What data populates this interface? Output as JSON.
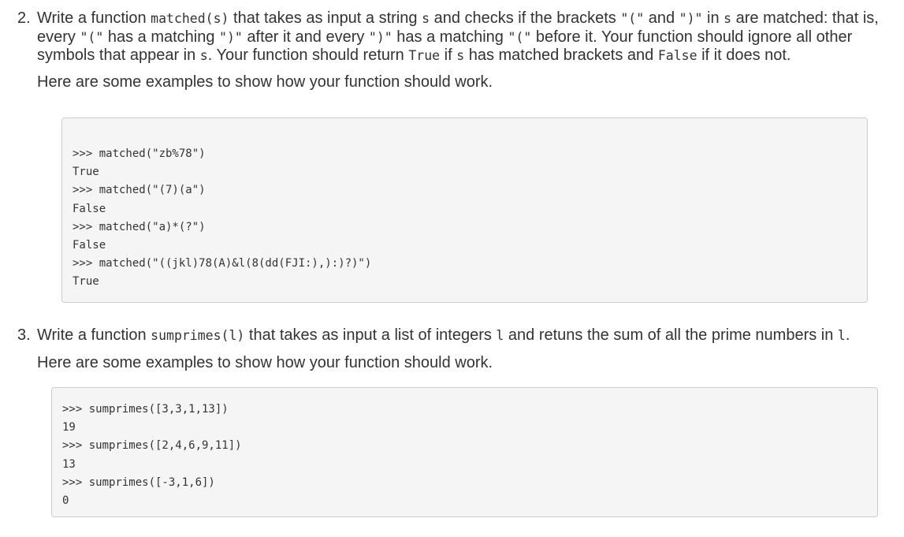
{
  "q2": {
    "number": "2.",
    "segments": [
      {
        "t": "Write a function "
      },
      {
        "c": "matched(s)"
      },
      {
        "t": " that takes as input a string "
      },
      {
        "c": "s"
      },
      {
        "t": " and checks if the brackets "
      },
      {
        "c": "\"(\""
      },
      {
        "t": " and "
      },
      {
        "c": "\")\""
      },
      {
        "t": " in "
      },
      {
        "c": "s"
      },
      {
        "t": " are matched: that is, every "
      },
      {
        "c": "\"(\""
      },
      {
        "t": " has a matching "
      },
      {
        "c": "\")\""
      },
      {
        "t": " after it and every "
      },
      {
        "c": "\")\""
      },
      {
        "t": " has a matching "
      },
      {
        "c": "\"(\""
      },
      {
        "t": " before it. Your function should ignore all other symbols that appear in "
      },
      {
        "c": "s"
      },
      {
        "t": ". Your function should return "
      },
      {
        "c": "True"
      },
      {
        "t": " if "
      },
      {
        "c": "s"
      },
      {
        "t": " has matched brackets and "
      },
      {
        "c": "False"
      },
      {
        "t": " if it does not."
      }
    ],
    "intro": "Here are some examples to show how your function should work.",
    "code_lines": [
      ">>> matched(\"zb%78\")",
      "True",
      ">>> matched(\"(7)(a\")",
      "False",
      ">>> matched(\"a)*(?\")",
      "False",
      ">>> matched(\"((jkl)78(A)&l(8(dd(FJI:),):)?)\")",
      "True"
    ]
  },
  "q3": {
    "number": "3.",
    "segments": [
      {
        "t": "Write a function "
      },
      {
        "c": "sumprimes(l)"
      },
      {
        "t": " that takes as input a list of integers "
      },
      {
        "c": "l"
      },
      {
        "t": " and retuns the sum of all the prime numbers in "
      },
      {
        "c": "l"
      },
      {
        "t": "."
      }
    ],
    "intro": "Here are some examples to show how your function should work.",
    "code_lines": [
      ">>> sumprimes([3,3,1,13])",
      "19",
      ">>> sumprimes([2,4,6,9,11])",
      "13",
      ">>> sumprimes([-3,1,6])",
      "0"
    ]
  }
}
